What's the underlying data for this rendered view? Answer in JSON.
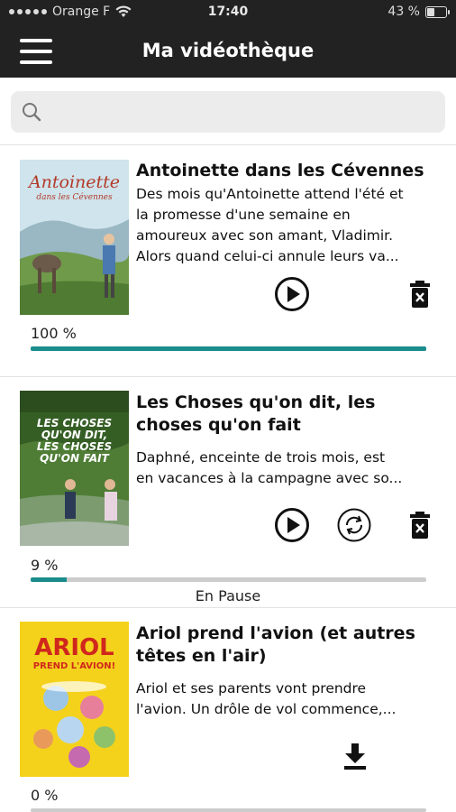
{
  "status": {
    "carrier": "Orange F",
    "time": "17:40",
    "battery": "43 %",
    "battery_level": 0.43
  },
  "header": {
    "title": "Ma vidéothèque"
  },
  "search": {
    "placeholder": ""
  },
  "items": [
    {
      "title_lines": [
        "Antoinette dans les Cévennes"
      ],
      "description_lines": [
        "Des mois qu'Antoinette attend l'été et",
        "la promesse d'une semaine en",
        "amoureux avec son amant, Vladimir.",
        "Alors quand celui-ci annule leurs va..."
      ],
      "progress": 1.0,
      "progress_label": "100 %",
      "status_text": "",
      "poster": {
        "lines": [
          "Antoinette",
          "dans les Cévennes"
        ],
        "bg": "#9fc2d2",
        "accent": "#5b7a3a"
      }
    },
    {
      "title_lines": [
        "Les Choses qu'on dit, les",
        "choses qu'on fait"
      ],
      "description_lines": [
        "Daphné, enceinte de trois mois, est",
        "en vacances à la campagne avec so..."
      ],
      "progress": 0.09,
      "progress_label": "9 %",
      "status_text": "En Pause",
      "poster": {
        "lines": [
          "LES CHOSES",
          "QU'ON DIT,",
          "LES CHOSES",
          "QU'ON FAIT"
        ],
        "bg": "#3f6a2c",
        "accent": "#8db36a"
      }
    },
    {
      "title_lines": [
        "Ariol prend l'avion (et autres",
        "têtes en l'air)"
      ],
      "description_lines": [
        "Ariol et ses parents vont prendre",
        "l'avion. Un drôle de vol commence,..."
      ],
      "progress": 0.0,
      "progress_label": "0 %",
      "status_text": "",
      "poster": {
        "lines": [
          "ARIOL",
          "PREND L'AVION!"
        ],
        "bg": "#f4d21c",
        "accent": "#d0271d"
      }
    }
  ],
  "icons": {
    "play": "play-circle-icon",
    "delete": "trash-icon",
    "retry": "refresh-circle-icon",
    "download": "download-icon",
    "search": "search-icon",
    "menu": "hamburger-menu-icon"
  },
  "colors": {
    "appbar": "#222222",
    "progress": "#1a8c8c",
    "progress_track": "#cccccc"
  }
}
